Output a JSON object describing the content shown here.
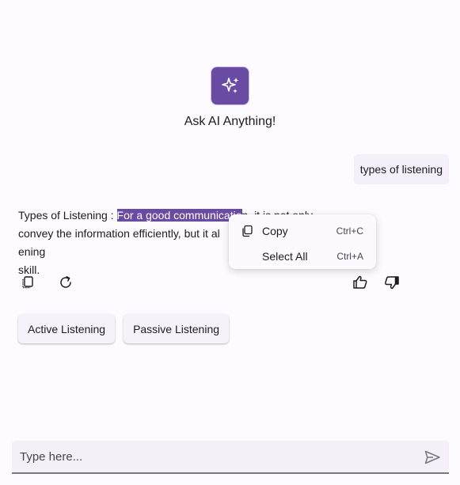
{
  "hero": {
    "icon": "sparkle-icon",
    "title": "Ask AI Anything!",
    "accent": "#6a4ba4"
  },
  "conversation": {
    "user_message": "types of listening",
    "response": {
      "prefix": "Types of Listening : ",
      "selected": "For a good communicatio",
      "hidden_fragment": "n, it is not only ",
      "line1_tail": "convey the information efficiently, but it al",
      "line1_end": "ening",
      "line2": "skill."
    },
    "actions": {
      "copy_icon": "copy-icon",
      "regenerate_icon": "refresh-icon",
      "like_icon": "thumbs-up-icon",
      "dislike_icon": "thumbs-down-icon"
    },
    "suggestions": [
      "Active Listening",
      "Passive Listening"
    ]
  },
  "context_menu": {
    "items": [
      {
        "label": "Copy",
        "shortcut": "Ctrl+C",
        "icon": "copy-icon"
      },
      {
        "label": "Select All",
        "shortcut": "Ctrl+A",
        "icon": ""
      }
    ]
  },
  "composer": {
    "value": "",
    "placeholder": "Type here...",
    "send_icon": "send-icon"
  }
}
